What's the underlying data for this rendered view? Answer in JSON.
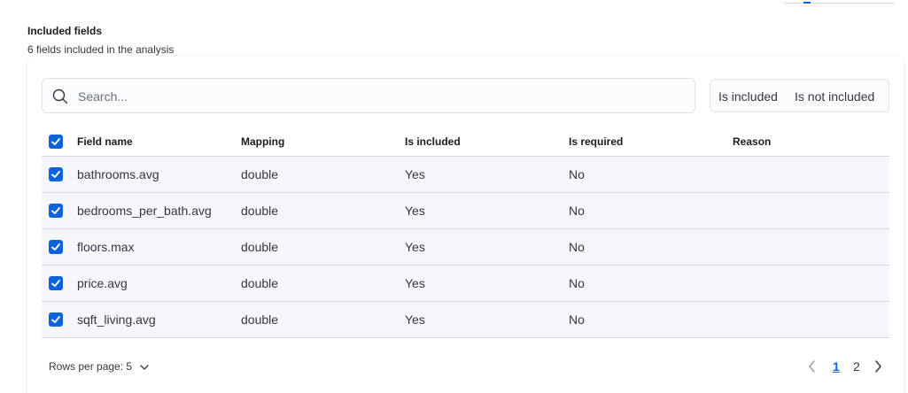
{
  "section": {
    "title": "Included fields",
    "subtitle": "6 fields included in the analysis"
  },
  "search": {
    "placeholder": "Search..."
  },
  "filters": {
    "included_label": "Is included",
    "not_included_label": "Is not included"
  },
  "table": {
    "columns": [
      "Field name",
      "Mapping",
      "Is included",
      "Is required",
      "Reason"
    ],
    "rows": [
      {
        "field": "bathrooms.avg",
        "mapping": "double",
        "included": "Yes",
        "required": "No",
        "reason": "",
        "checked": true
      },
      {
        "field": "bedrooms_per_bath.avg",
        "mapping": "double",
        "included": "Yes",
        "required": "No",
        "reason": "",
        "checked": true
      },
      {
        "field": "floors.max",
        "mapping": "double",
        "included": "Yes",
        "required": "No",
        "reason": "",
        "checked": true
      },
      {
        "field": "price.avg",
        "mapping": "double",
        "included": "Yes",
        "required": "No",
        "reason": "",
        "checked": true
      },
      {
        "field": "sqft_living.avg",
        "mapping": "double",
        "included": "Yes",
        "required": "No",
        "reason": "",
        "checked": true
      }
    ],
    "select_all_checked": true
  },
  "footer": {
    "rows_per_page_label": "Rows per page: 5",
    "pages": [
      "1",
      "2"
    ],
    "current_page": "1"
  },
  "colors": {
    "accent": "#0b64dd",
    "row_bg": "#f5f7fa",
    "border": "#d3dae6"
  }
}
